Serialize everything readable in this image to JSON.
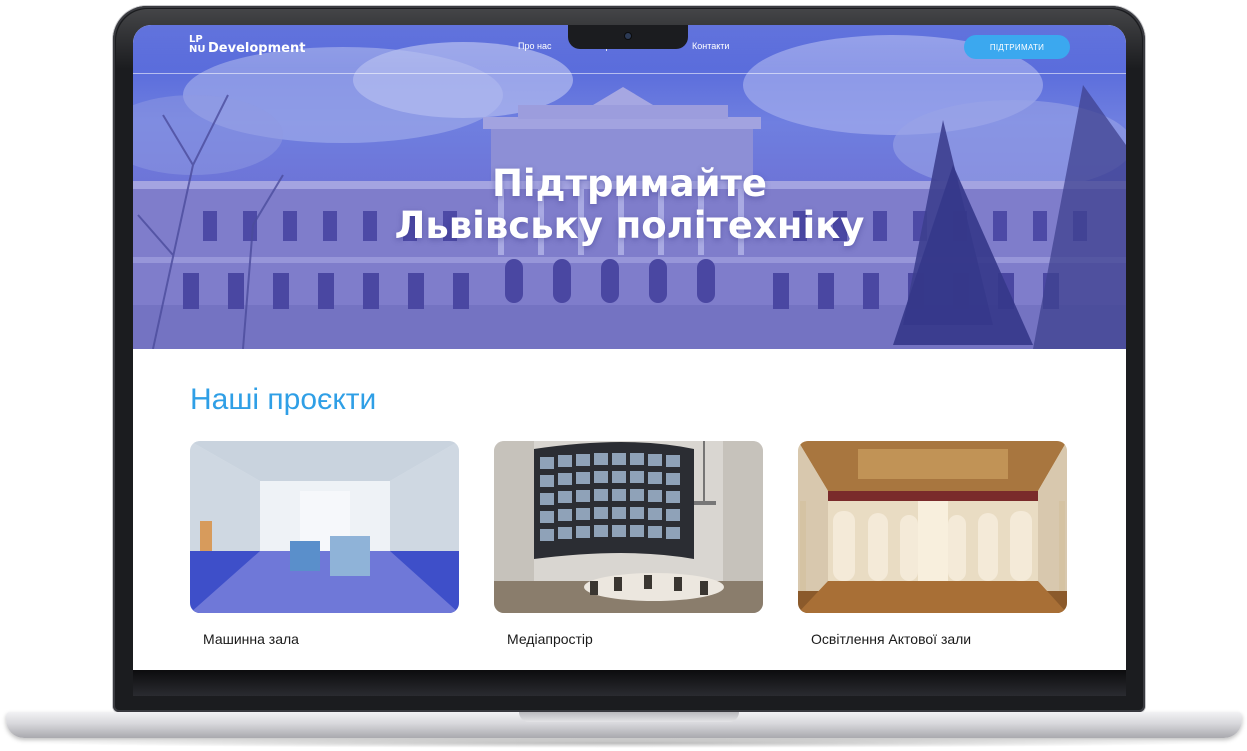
{
  "nav": {
    "logo_mark": "LP\nNU",
    "logo_text": "Development",
    "links": [
      "Про нас",
      "Проєкти",
      "Контакти"
    ],
    "support_label": "ПІДТРИМАТИ"
  },
  "hero": {
    "title_line1": "Підтримайте",
    "title_line2": "Львівську політехніку"
  },
  "projects": {
    "heading": "Наші проєкти",
    "items": [
      {
        "label": "Машинна зала"
      },
      {
        "label": "Медіапростір"
      },
      {
        "label": "Освітлення Актової зали"
      }
    ]
  },
  "colors": {
    "accent": "#3ba8ef",
    "heading": "#2f9fe6",
    "hero_overlay": "#5f6ad6"
  }
}
